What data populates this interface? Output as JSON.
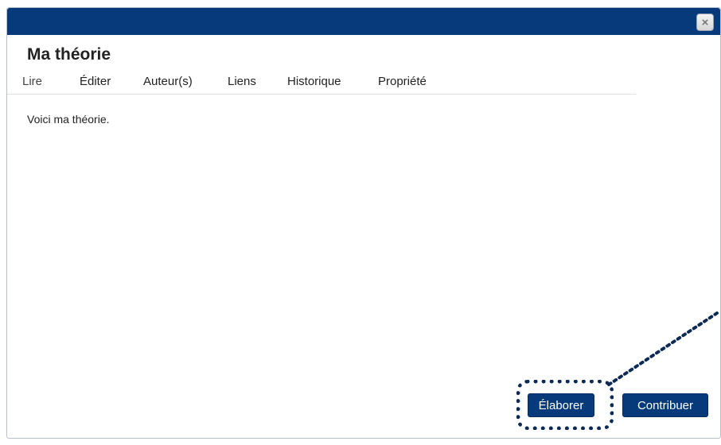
{
  "dialog": {
    "title": "Ma théorie",
    "close_label": "×",
    "tabs": [
      {
        "label": "Lire",
        "active": true
      },
      {
        "label": "Éditer",
        "active": false
      },
      {
        "label": "Auteur(s)",
        "active": false
      },
      {
        "label": "Liens",
        "active": false
      },
      {
        "label": "Historique",
        "active": false
      },
      {
        "label": "Propriété",
        "active": false
      }
    ],
    "content": "Voici ma théorie.",
    "buttons": {
      "elaborer": "Élaborer",
      "contribuer": "Contribuer"
    }
  },
  "colors": {
    "titlebar": "#063a7a",
    "button": "#063a7a",
    "highlight": "#0b2a55"
  }
}
